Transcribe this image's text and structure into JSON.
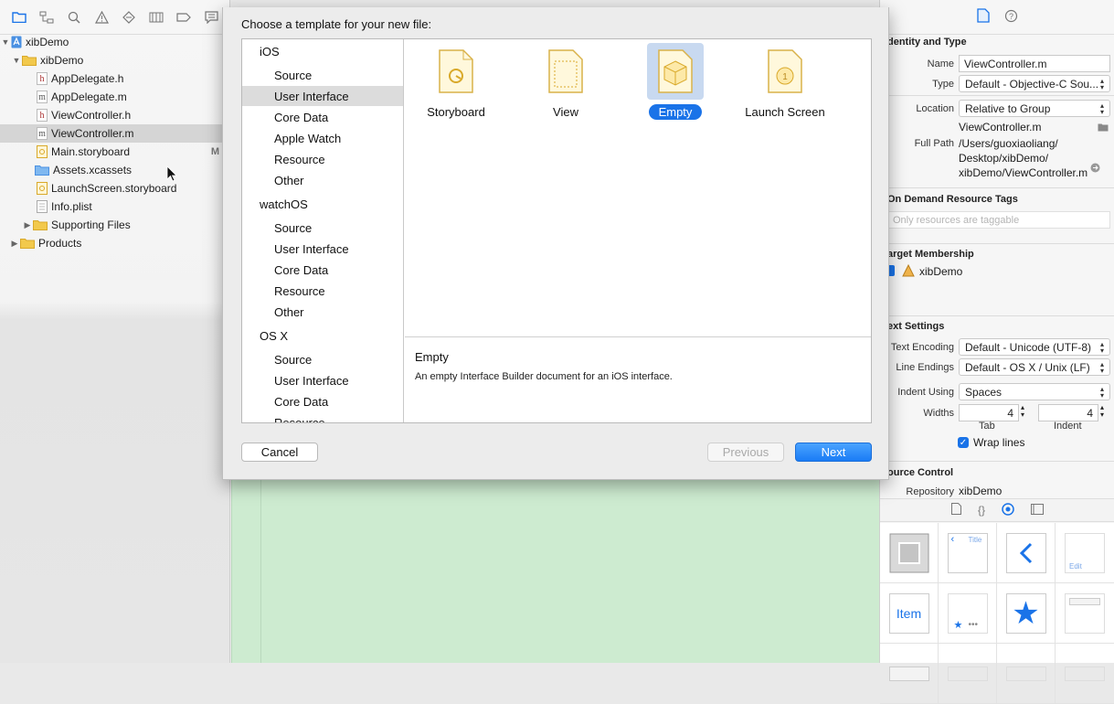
{
  "navigator": {
    "tree": [
      {
        "label": "xibDemo",
        "kind": "project",
        "indent": 0,
        "disclosure": "▼"
      },
      {
        "label": "xibDemo",
        "kind": "folder",
        "indent": 1,
        "disclosure": "▼"
      },
      {
        "label": "AppDelegate.h",
        "kind": "h",
        "indent": 2
      },
      {
        "label": "AppDelegate.m",
        "kind": "m",
        "indent": 2
      },
      {
        "label": "ViewController.h",
        "kind": "h",
        "indent": 2
      },
      {
        "label": "ViewController.m",
        "kind": "m",
        "indent": 2,
        "selected": true
      },
      {
        "label": "Main.storyboard",
        "kind": "storyboard",
        "indent": 2,
        "badge": "M"
      },
      {
        "label": "Assets.xcassets",
        "kind": "assets",
        "indent": 2
      },
      {
        "label": "LaunchScreen.storyboard",
        "kind": "storyboard",
        "indent": 2
      },
      {
        "label": "Info.plist",
        "kind": "plist",
        "indent": 2
      },
      {
        "label": "Supporting Files",
        "kind": "folder",
        "indent": 1,
        "disclosure": "▶"
      },
      {
        "label": "Products",
        "kind": "folder",
        "indent": 0,
        "disclosure": "▶"
      }
    ]
  },
  "sheet": {
    "title": "Choose a template for your new file:",
    "categories": {
      "ios": {
        "label": "iOS",
        "items": [
          "Source",
          "User Interface",
          "Core Data",
          "Apple Watch",
          "Resource",
          "Other"
        ]
      },
      "watchos": {
        "label": "watchOS",
        "items": [
          "Source",
          "User Interface",
          "Core Data",
          "Resource",
          "Other"
        ]
      },
      "osx": {
        "label": "OS X",
        "items": [
          "Source",
          "User Interface",
          "Core Data",
          "Resource"
        ]
      }
    },
    "selected_category": "User Interface",
    "templates": [
      "Storyboard",
      "View",
      "Empty",
      "Launch Screen"
    ],
    "selected_template": "Empty",
    "description_title": "Empty",
    "description_text": "An empty Interface Builder document for an iOS interface.",
    "buttons": {
      "cancel": "Cancel",
      "previous": "Previous",
      "next": "Next"
    }
  },
  "inspector": {
    "identity_header": "dentity and Type",
    "name_label": "Name",
    "name_value": "ViewController.m",
    "type_label": "Type",
    "type_value": "Default - Objective-C Sou...",
    "location_label": "Location",
    "location_value": "Relative to Group",
    "location_file": "ViewController.m",
    "fullpath_label": "Full Path",
    "fullpath_lines": [
      "/Users/guoxiaoliang/",
      "Desktop/xibDemo/",
      "xibDemo/ViewController.m"
    ],
    "ondemand_header": "On Demand Resource Tags",
    "ondemand_placeholder": "Only resources are taggable",
    "target_header": "arget Membership",
    "target_name": "xibDemo",
    "text_header": "ext Settings",
    "encoding_label": "Text Encoding",
    "encoding_value": "Default - Unicode (UTF-8)",
    "lineendings_label": "Line Endings",
    "lineendings_value": "Default - OS X / Unix (LF)",
    "indent_label": "Indent Using",
    "indent_value": "Spaces",
    "widths_label": "Widths",
    "tab_value": "4",
    "indent_width_value": "4",
    "tab_caption": "Tab",
    "indent_caption": "Indent",
    "wrap_label": "Wrap lines",
    "source_header": "ource Control",
    "repository_label": "Repository",
    "repository_value": "xibDemo"
  },
  "library": {
    "item_label": "Item",
    "title_label": "Title",
    "edit_label": "Edit"
  },
  "colors": {
    "accent": "#1a7cf5",
    "selection": "#d5d5d5",
    "canvas_green": "#cdebd0"
  }
}
